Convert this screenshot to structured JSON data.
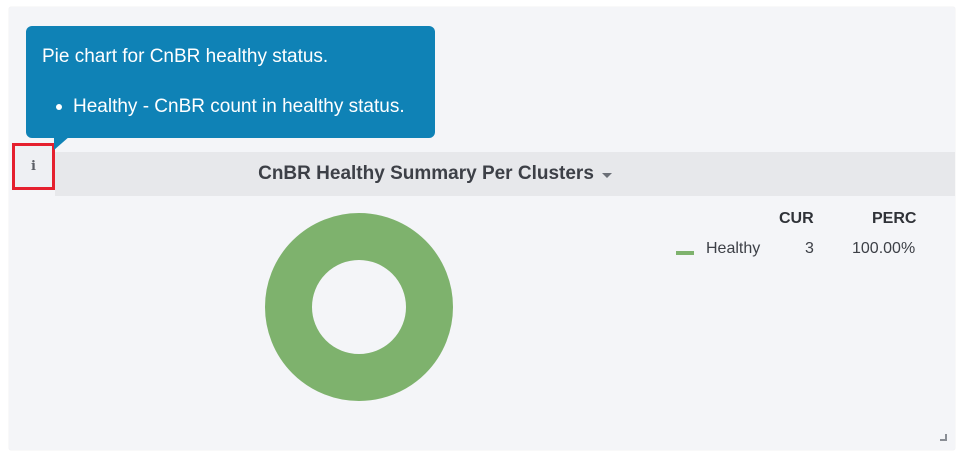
{
  "tooltip": {
    "title": "Pie chart for CnBR healthy status.",
    "items": [
      "Healthy - CnBR count in healthy status."
    ]
  },
  "panel": {
    "title": "CnBR Healthy Summary Per Clusters",
    "info_icon": "info-icon"
  },
  "legend": {
    "columns": [
      "CUR",
      "PERC"
    ],
    "rows": [
      {
        "label": "Healthy",
        "cur": "3",
        "perc": "100.00%"
      }
    ]
  },
  "colors": {
    "healthy": "#7eb26d",
    "tooltip_bg": "#0f82b6",
    "highlight_border": "#e5202e"
  },
  "chart_data": {
    "type": "pie",
    "variant": "donut",
    "categories": [
      "Healthy"
    ],
    "values": [
      3
    ],
    "percentages": [
      100.0
    ],
    "title": "CnBR Healthy Summary Per Clusters",
    "legend_placement": "right"
  }
}
